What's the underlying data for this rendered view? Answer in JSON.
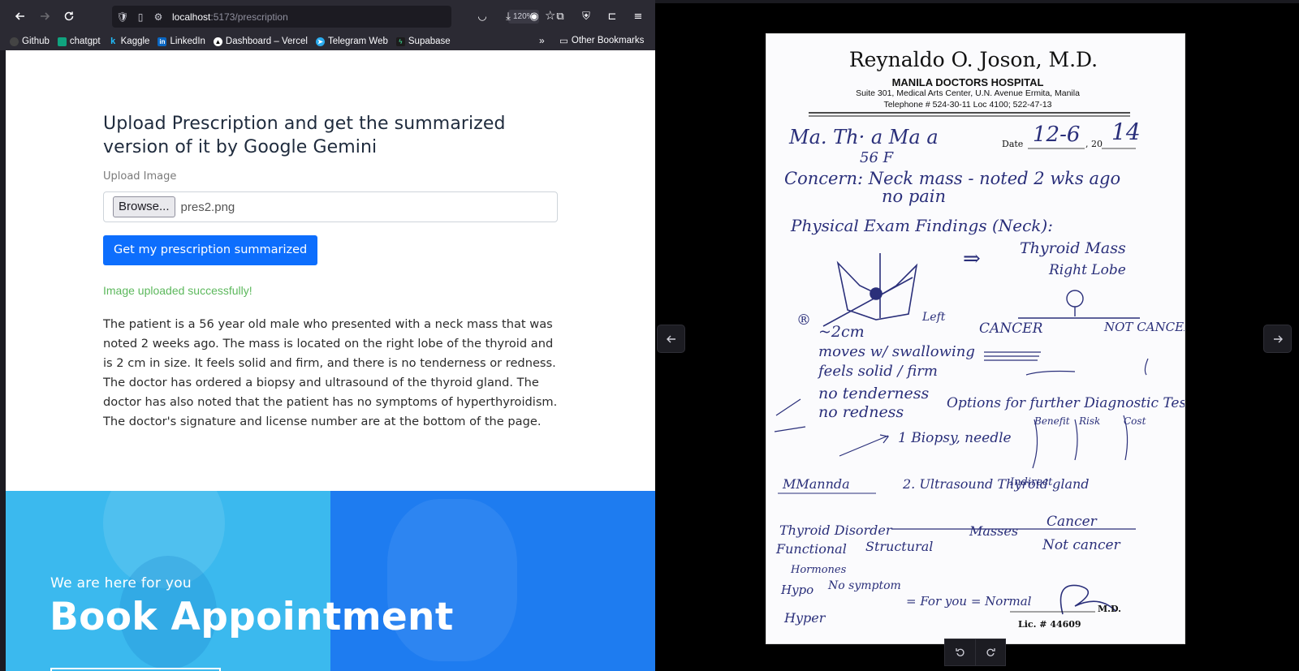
{
  "browser": {
    "url_host": "localhost",
    "url_path": ":5173/prescription",
    "zoom": "120%",
    "bookmarks": [
      {
        "label": "Github",
        "color": "#444"
      },
      {
        "label": "chatgpt",
        "color": "#10a37f"
      },
      {
        "label": "Kaggle",
        "color": "#20beff"
      },
      {
        "label": "LinkedIn",
        "color": "#0a66c2"
      },
      {
        "label": "Dashboard – Vercel",
        "color": "#000"
      },
      {
        "label": "Telegram Web",
        "color": "#2aabee"
      },
      {
        "label": "Supabase",
        "color": "#3ecf8e"
      }
    ],
    "other_bookmarks": "Other Bookmarks"
  },
  "page": {
    "title": "Upload Prescription and get the summarized version of it by Google Gemini",
    "upload_label": "Upload Image",
    "browse_label": "Browse...",
    "file_name": "pres2.png",
    "submit_label": "Get my prescription summarized",
    "success_message": "Image uploaded successfully!",
    "summary": "The patient is a 56 year old male who presented with a neck mass that was noted 2 weeks ago. The mass is located on the right lobe of the thyroid and is 2 cm in size. It feels solid and firm, and there is no tenderness or redness. The doctor has ordered a biopsy and ultrasound of the thyroid gland. The doctor has also noted that the patient has no symptoms of hyperthyroidism. The doctor's signature and license number are at the bottom of the page."
  },
  "appointment": {
    "subtitle": "We are here for you",
    "title": "Book Appointment"
  },
  "prescription": {
    "doctor": "Reynaldo O. Joson, M.D.",
    "hospital": "MANILA DOCTORS HOSPITAL",
    "address": "Suite 301, Medical Arts Center, U.N. Avenue Ermita, Manila",
    "telephone": "Telephone # 524-30-11 Loc 4100; 522-47-13",
    "date_label": "Date",
    "date_value": "12-6",
    "year_prefix": ", 20",
    "year_value": "14",
    "license": "Lic. # 44609",
    "md": "M.D.",
    "handwriting": [
      "Ma. Th·  a Ma    a",
      "56 F",
      "Concern: Neck mass - noted 2 wks ago",
      "no pain",
      "Physical Exam Findings (Neck):",
      "Thyroid Mass",
      "Right Lobe",
      "CANCER",
      "NOT CANCER",
      "~2cm",
      "moves w/ swallowing",
      "feels solid / firm",
      "no tenderness",
      "no redness",
      "Options for further Diagnostic Test:",
      "1 Biopsy, needle",
      "2. Ultrasound Thyroid gland",
      "Thyroid Disorder",
      "Functional",
      "Structural",
      "Masses",
      "Cancer",
      "Not cancer",
      "Hormones",
      "Hypo",
      "No symptom",
      "= For you = Normal",
      "Hyper"
    ]
  }
}
